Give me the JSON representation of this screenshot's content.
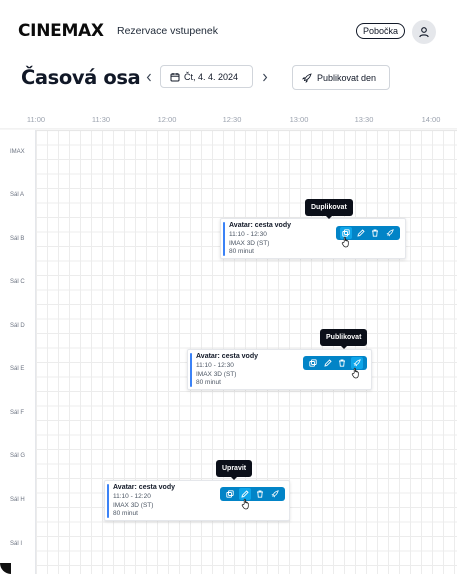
{
  "header": {
    "logo": "CINEMAX",
    "subtitle": "Rezervace vstupenek",
    "branch_button": "Pobočka",
    "user_icon": "user-icon"
  },
  "toolbar": {
    "title": "Časová osa",
    "prev_icon": "chevron-left-icon",
    "next_icon": "chevron-right-icon",
    "date": "Čt, 4. 4. 2024",
    "calendar_icon": "calendar-icon",
    "publish_day": "Publikovat den",
    "rocket_icon": "rocket-icon"
  },
  "timeline": {
    "times": [
      "11:00",
      "11:30",
      "12:00",
      "12:30",
      "13:00",
      "13:30",
      "14:00"
    ],
    "halls": [
      "IMAX",
      "Sál A",
      "Sál B",
      "Sál C",
      "Sál D",
      "Sál E",
      "Sál F",
      "Sál G",
      "Sál H",
      "Sál I"
    ]
  },
  "events": [
    {
      "hall": "Sál B",
      "title": "Avatar: cesta vody",
      "time": "11:10 - 12:30",
      "format": "IMAX 3D (ST)",
      "duration": "80 minut",
      "tooltip": "Duplikovat",
      "hovered_action": "duplicate"
    },
    {
      "hall": "Sál E",
      "title": "Avatar: cesta vody",
      "time": "11:10 - 12:30",
      "format": "IMAX 3D (ST)",
      "duration": "80 minut",
      "tooltip": "Publikovat",
      "hovered_action": "publish"
    },
    {
      "hall": "Sál H",
      "title": "Avatar: cesta vody",
      "time": "11:10 - 12:20",
      "format": "IMAX 3D (ST)",
      "duration": "80 minut",
      "tooltip": "Upravit",
      "hovered_action": "edit"
    }
  ],
  "actions": [
    "duplicate-icon",
    "edit-icon",
    "delete-icon",
    "publish-icon"
  ],
  "colors": {
    "accent": "#0284c7",
    "event_bar": "#3b82f6",
    "tooltip_bg": "#0b0f19"
  }
}
